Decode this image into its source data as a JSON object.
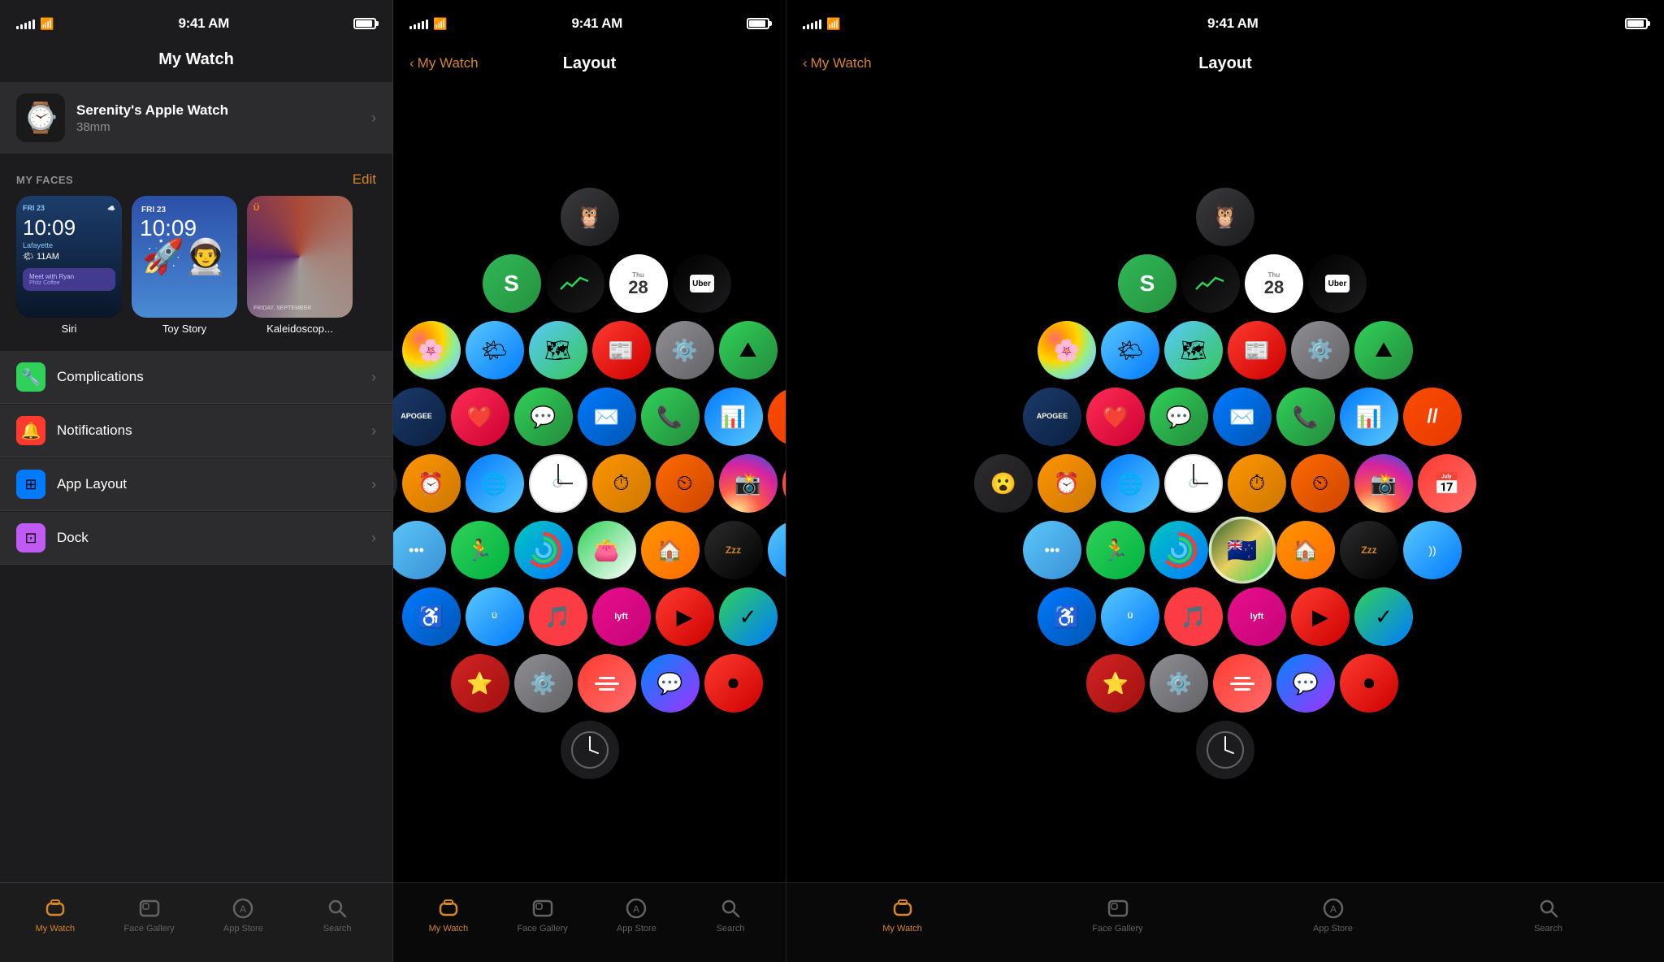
{
  "panels": [
    {
      "id": "panel1",
      "status": {
        "time": "9:41 AM",
        "signal": [
          3,
          5,
          7,
          9,
          11
        ],
        "wifi": true
      },
      "title": "My Watch",
      "watch": {
        "name": "Serenity's Apple Watch",
        "size": "38mm",
        "emoji": "⌚"
      },
      "faces_section": "MY FACES",
      "edit_label": "Edit",
      "faces": [
        {
          "name": "Siri",
          "type": "siri"
        },
        {
          "name": "Toy Story",
          "type": "toy"
        },
        {
          "name": "Kaleidoscop...",
          "type": "kaleid"
        }
      ],
      "menu_items": [
        {
          "icon": "🔧",
          "label": "Complications",
          "color": "green",
          "id": "complications"
        },
        {
          "icon": "🔔",
          "label": "Notifications",
          "color": "red",
          "id": "notifications"
        },
        {
          "icon": "⊞",
          "label": "App Layout",
          "color": "blue",
          "id": "app-layout"
        },
        {
          "icon": "⊡",
          "label": "Dock",
          "color": "purple",
          "id": "dock"
        }
      ],
      "tabs": [
        {
          "label": "My Watch",
          "active": true,
          "id": "my-watch"
        },
        {
          "label": "Face Gallery",
          "active": false,
          "id": "face-gallery"
        },
        {
          "label": "App Store",
          "active": false,
          "id": "app-store"
        },
        {
          "label": "Search",
          "active": false,
          "id": "search"
        }
      ]
    },
    {
      "id": "panel2",
      "status": {
        "time": "9:41 AM"
      },
      "back_label": "My Watch",
      "title": "Layout",
      "tabs": [
        {
          "label": "My Watch",
          "active": true,
          "id": "my-watch"
        },
        {
          "label": "Face Gallery",
          "active": false,
          "id": "face-gallery"
        },
        {
          "label": "App Store",
          "active": false,
          "id": "app-store"
        },
        {
          "label": "Search",
          "active": false,
          "id": "search"
        }
      ]
    },
    {
      "id": "panel3",
      "status": {
        "time": "9:41 AM"
      },
      "back_label": "My Watch",
      "title": "Layout",
      "tabs": [
        {
          "label": "My Watch",
          "active": true,
          "id": "my-watch"
        },
        {
          "label": "Face Gallery",
          "active": false,
          "id": "face-gallery"
        },
        {
          "label": "App Store",
          "active": false,
          "id": "app-store"
        },
        {
          "label": "Search",
          "active": false,
          "id": "search"
        }
      ]
    }
  ]
}
